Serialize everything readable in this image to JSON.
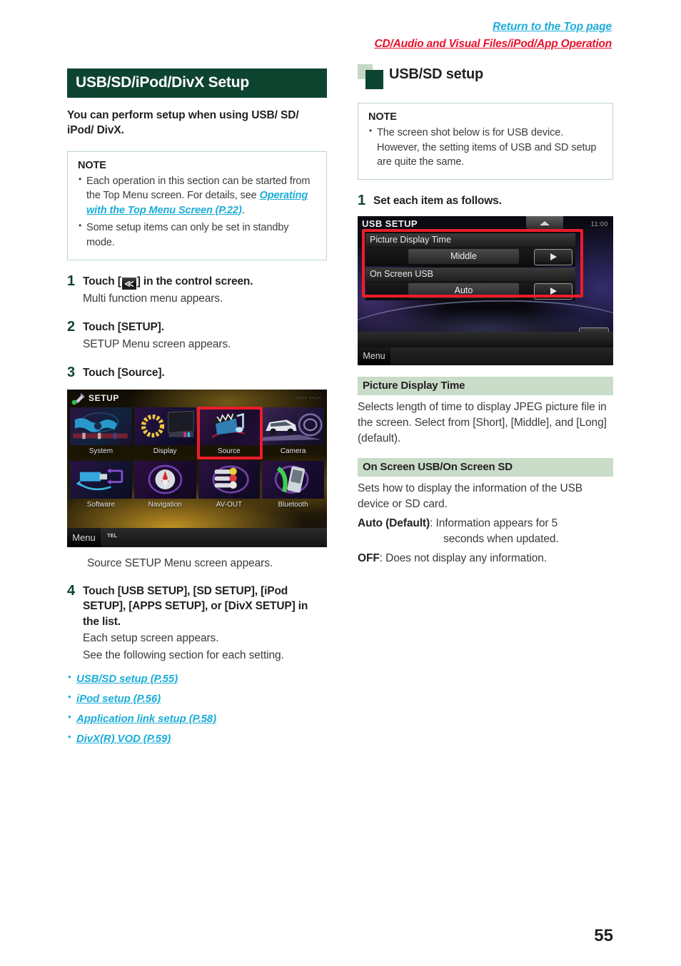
{
  "topnav": {
    "return_link": "Return to the Top page",
    "breadcrumb": "CD/Audio and Visual Files/iPod/App Operation"
  },
  "colors": {
    "dark_green": "#0d4430",
    "light_green": "#c8dcc8",
    "link_blue": "#1badd8",
    "breadcrumb_red": "#e8112d",
    "highlight_red": "#ee1c2a"
  },
  "left": {
    "chapter_title": "USB/SD/iPod/DivX Setup",
    "intro": "You can perform setup when using USB/ SD/ iPod/ DivX.",
    "note": {
      "title": "NOTE",
      "items": [
        {
          "text_before": "Each operation in this section can be started from the Top Menu screen. For details, see ",
          "link": "Operating with the Top Menu Screen (P.22)",
          "text_after": "."
        },
        {
          "text_before": "Some setup items can only be set in standby mode.",
          "link": "",
          "text_after": ""
        }
      ]
    },
    "steps": [
      {
        "num": "1",
        "head_before": "Touch [",
        "glyph": "≪",
        "head_after": "] in the control screen.",
        "sub": "Multi function menu appears."
      },
      {
        "num": "2",
        "head_before": "Touch [SETUP].",
        "glyph": "",
        "head_after": "",
        "sub": "SETUP Menu screen appears."
      },
      {
        "num": "3",
        "head_before": "Touch [Source].",
        "glyph": "",
        "head_after": "",
        "sub": ""
      }
    ],
    "setup_screenshot": {
      "title": "SETUP",
      "clock": "--:--  --:--",
      "menu_label": "Menu",
      "tel_label": "TEL",
      "tiles": [
        {
          "label": "System",
          "highlighted": false
        },
        {
          "label": "Display",
          "highlighted": false
        },
        {
          "label": "Source",
          "highlighted": true
        },
        {
          "label": "Camera",
          "highlighted": false
        },
        {
          "label": "Software",
          "highlighted": false
        },
        {
          "label": "Navigation",
          "highlighted": false
        },
        {
          "label": "AV-OUT",
          "highlighted": false
        },
        {
          "label": "Bluetooth",
          "highlighted": false
        }
      ]
    },
    "after_shot_caption": "Source SETUP Menu screen appears.",
    "step4": {
      "num": "4",
      "head": "Touch [USB SETUP], [SD SETUP], [iPod SETUP], [APPS SETUP], or [DivX SETUP] in the list.",
      "sub1": "Each setup screen appears.",
      "sub2": "See the following section for each setting."
    },
    "links": [
      "USB/SD setup (P.55)",
      "iPod setup (P.56)",
      "Application link setup (P.58)",
      "DivX(R) VOD (P.59)"
    ]
  },
  "right": {
    "section_title": "USB/SD setup",
    "note": {
      "title": "NOTE",
      "items": [
        "The screen shot below is for USB device. However, the setting items of USB and SD setup are quite the same."
      ]
    },
    "step1": {
      "num": "1",
      "head": "Set each item as follows."
    },
    "usb_screenshot": {
      "title": "USB SETUP",
      "clock": "11:00",
      "menu_label": "Menu",
      "back_label": "↩",
      "rows": [
        {
          "label": "Picture Display Time",
          "value": "Middle"
        },
        {
          "label": "On Screen USB",
          "value": "Auto"
        }
      ]
    },
    "settings": [
      {
        "heading": "Picture Display Time",
        "body": "Selects length of time to display JPEG picture file in the screen. Select from [Short], [Middle], and [Long] (default).",
        "options": []
      },
      {
        "heading": "On Screen USB/On Screen SD",
        "body": "Sets how to display the information of the USB device or SD card.",
        "options": [
          {
            "name": "Auto (Default)",
            "sep": ": ",
            "desc": "Information appears for 5",
            "desc2": "seconds when updated."
          },
          {
            "name": "OFF",
            "sep": ": ",
            "desc": "Does not display any information.",
            "desc2": ""
          }
        ]
      }
    ]
  },
  "page_number": "55"
}
